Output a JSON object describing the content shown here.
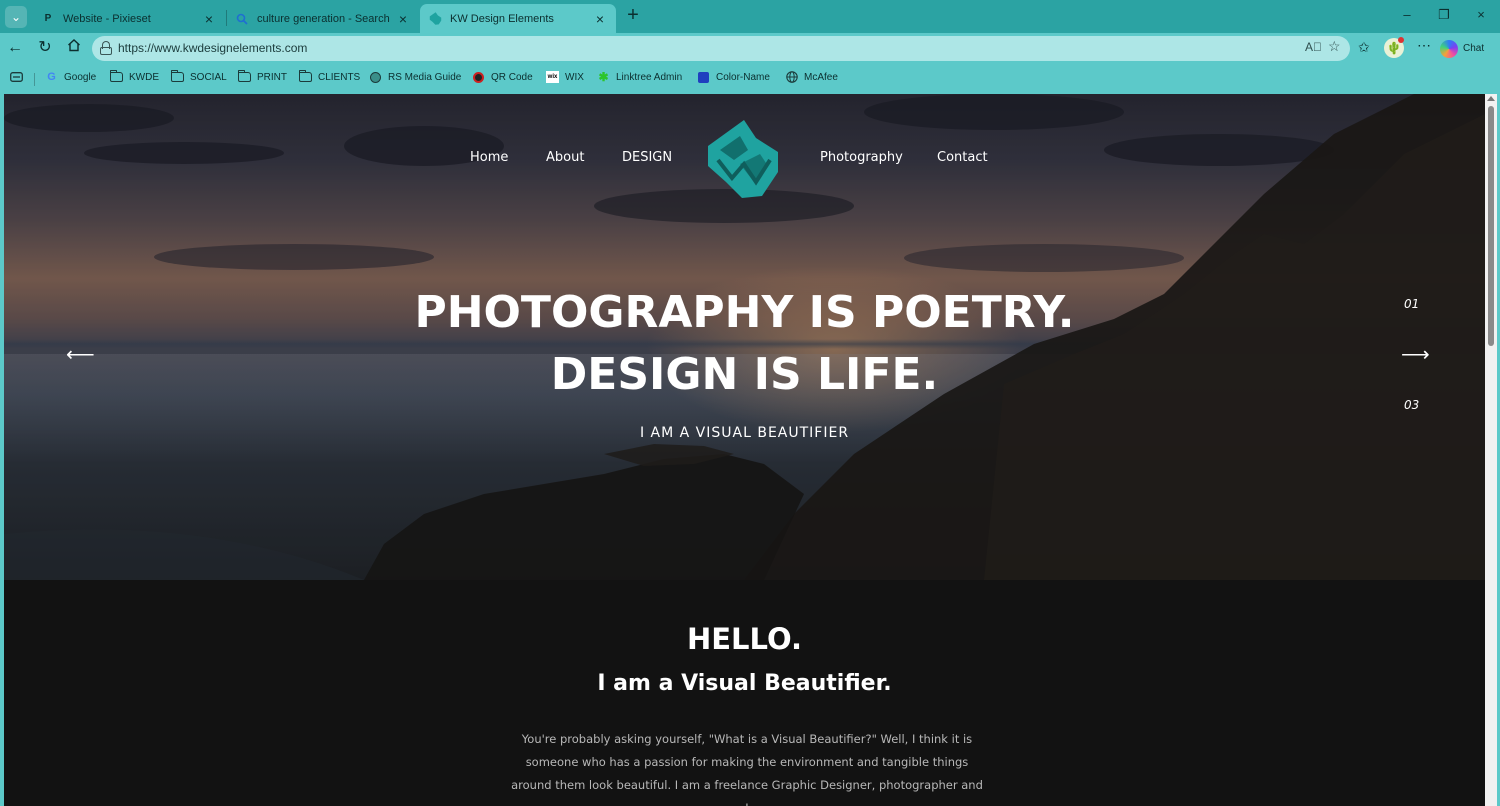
{
  "browser": {
    "tabs": [
      {
        "label": "Website - Pixieset",
        "favicon": "P",
        "active": false
      },
      {
        "label": "culture generation - Search",
        "favicon": "search-icon",
        "active": false
      },
      {
        "label": "KW Design Elements",
        "favicon": "kw-logo-icon",
        "active": true
      }
    ],
    "url": "https://www.kwdesignelements.com",
    "chat_label": "Chat",
    "accent_color": "#2ba3a3",
    "toolbar_color": "#5cc9c9"
  },
  "bookmarks": [
    {
      "label": "Google",
      "icon": "google-icon"
    },
    {
      "label": "KWDE",
      "icon": "folder-icon"
    },
    {
      "label": "SOCIAL",
      "icon": "folder-icon"
    },
    {
      "label": "PRINT",
      "icon": "folder-icon"
    },
    {
      "label": "CLIENTS",
      "icon": "folder-icon"
    },
    {
      "label": "RS Media Guide",
      "icon": "rs-media-icon"
    },
    {
      "label": "QR Code",
      "icon": "qr-code-icon"
    },
    {
      "label": "WIX",
      "icon": "wix-icon"
    },
    {
      "label": "Linktree Admin",
      "icon": "linktree-icon"
    },
    {
      "label": "Color-Name",
      "icon": "color-name-icon"
    },
    {
      "label": "McAfee",
      "icon": "globe-icon"
    }
  ],
  "site": {
    "nav": {
      "home": "Home",
      "about": "About",
      "design": "DESIGN",
      "photography": "Photography",
      "contact": "Contact"
    },
    "logo_color": "#1fa3a0",
    "hero": {
      "line1": "PHOTOGRAPHY IS POETRY.",
      "line2": "DESIGN IS LIFE.",
      "tagline": "I AM A VISUAL BEAUTIFIER",
      "slide_prev": "01",
      "slide_next": "03"
    },
    "intro": {
      "hello": "HELLO.",
      "subhead": "I am a Visual Beautifier.",
      "line1": "You're probably asking yourself, \"What is a Visual Beautifier?\" Well, I think it is",
      "line2": "someone who has a passion for making the environment and tangible things",
      "line3": "around them look beautiful. I am a freelance Graphic Designer, photographer and I"
    }
  }
}
